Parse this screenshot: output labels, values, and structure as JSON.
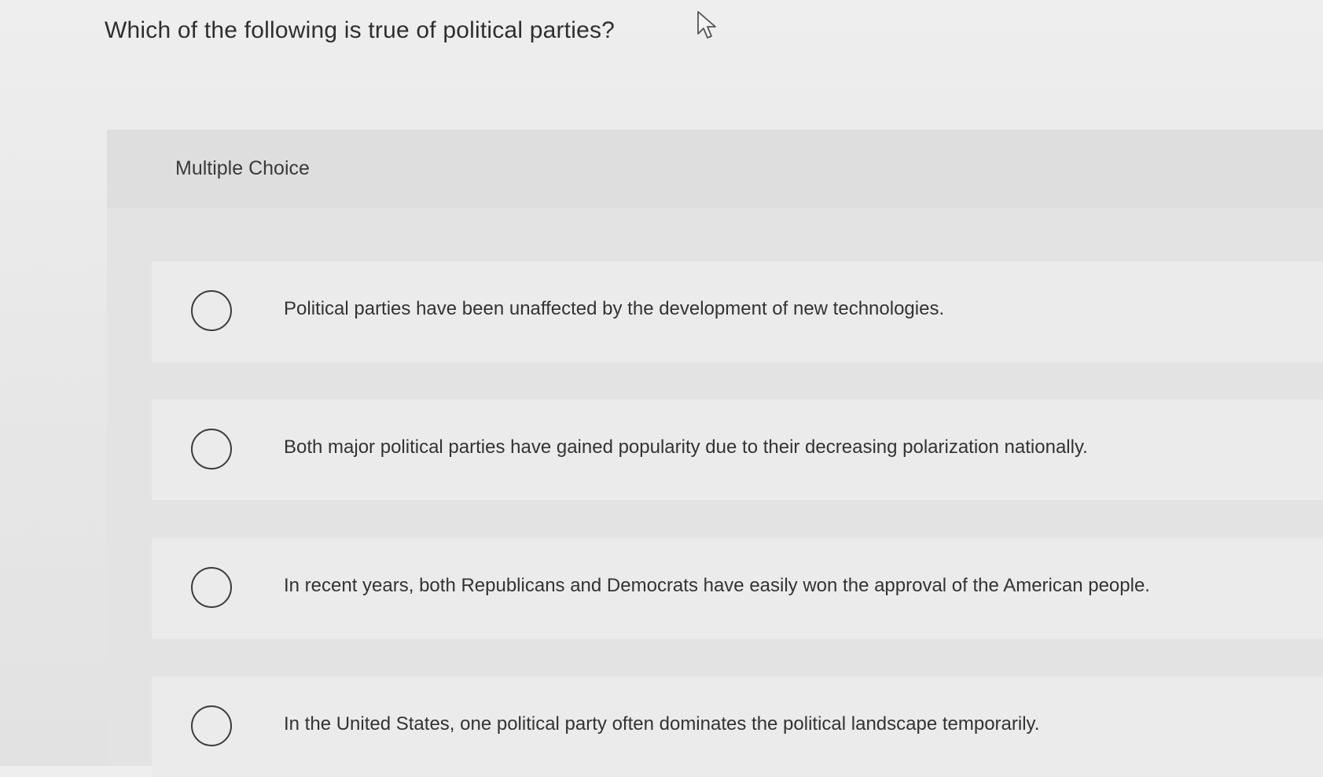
{
  "question": {
    "text": "Which of the following is true of political parties?"
  },
  "section": {
    "label": "Multiple Choice"
  },
  "options": [
    {
      "label": "Political parties have been unaffected by the development of new technologies."
    },
    {
      "label": "Both major political parties have gained popularity due to their decreasing polarization nationally."
    },
    {
      "label": "In recent years, both Republicans and Democrats have easily won the approval of the American people."
    },
    {
      "label": "In the United States, one political party often dominates the political landscape temporarily."
    }
  ],
  "icons": {
    "pointer": "mouse-pointer-icon",
    "radio": "radio-circle"
  }
}
